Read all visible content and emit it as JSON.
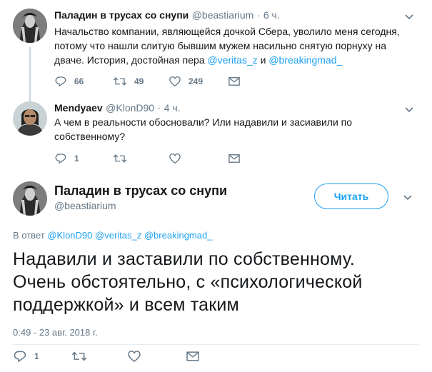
{
  "tweet1": {
    "name": "Паладин в трусах со снупи",
    "handle": "@beastiarium",
    "dot": "·",
    "time": "6 ч.",
    "text_lines": [
      "Начальство компании, являющейся дочкой Сбера, уволило меня сегодня,",
      "потому что нашли слитую бывшим мужем насильно снятую порнуху на",
      "дваче. История, достойная пера "
    ],
    "mention1": "@veritas_z",
    "conjunction": " и ",
    "mention2": "@breakingmad_",
    "replies": "66",
    "retweets": "49",
    "likes": "249"
  },
  "tweet2": {
    "name": "Mendyaev",
    "handle": "@KlonD90",
    "dot": "·",
    "time": "4 ч.",
    "text_lines": [
      "А чем в реальности обосновали? Или надавили и засиавили по",
      "собственному?"
    ],
    "replies": "1",
    "retweets": "",
    "likes": ""
  },
  "main": {
    "name": "Паладин в трусах со снупи",
    "handle": "@beastiarium",
    "follow_label": "Читать",
    "reply_prefix": "В ответ ",
    "reply_mentions": [
      "@KlonD90",
      "@veritas_z",
      "@breakingmad_"
    ],
    "text_lines": [
      "Надавили и заставили по собственному.",
      "Очень обстоятельно, с «психологической",
      "поддержкой» и всем таким"
    ],
    "timestamp": "0:49 - 23 авг. 2018 г.",
    "replies": "1",
    "retweets": "",
    "likes": ""
  },
  "colors": {
    "accent": "#1da1f2",
    "secondary_text": "#657786",
    "primary_text": "#14171a",
    "divider": "#e6ecf0"
  },
  "icons": [
    "reply-icon",
    "retweet-icon",
    "like-icon",
    "dm-icon",
    "chevron-down-icon"
  ]
}
